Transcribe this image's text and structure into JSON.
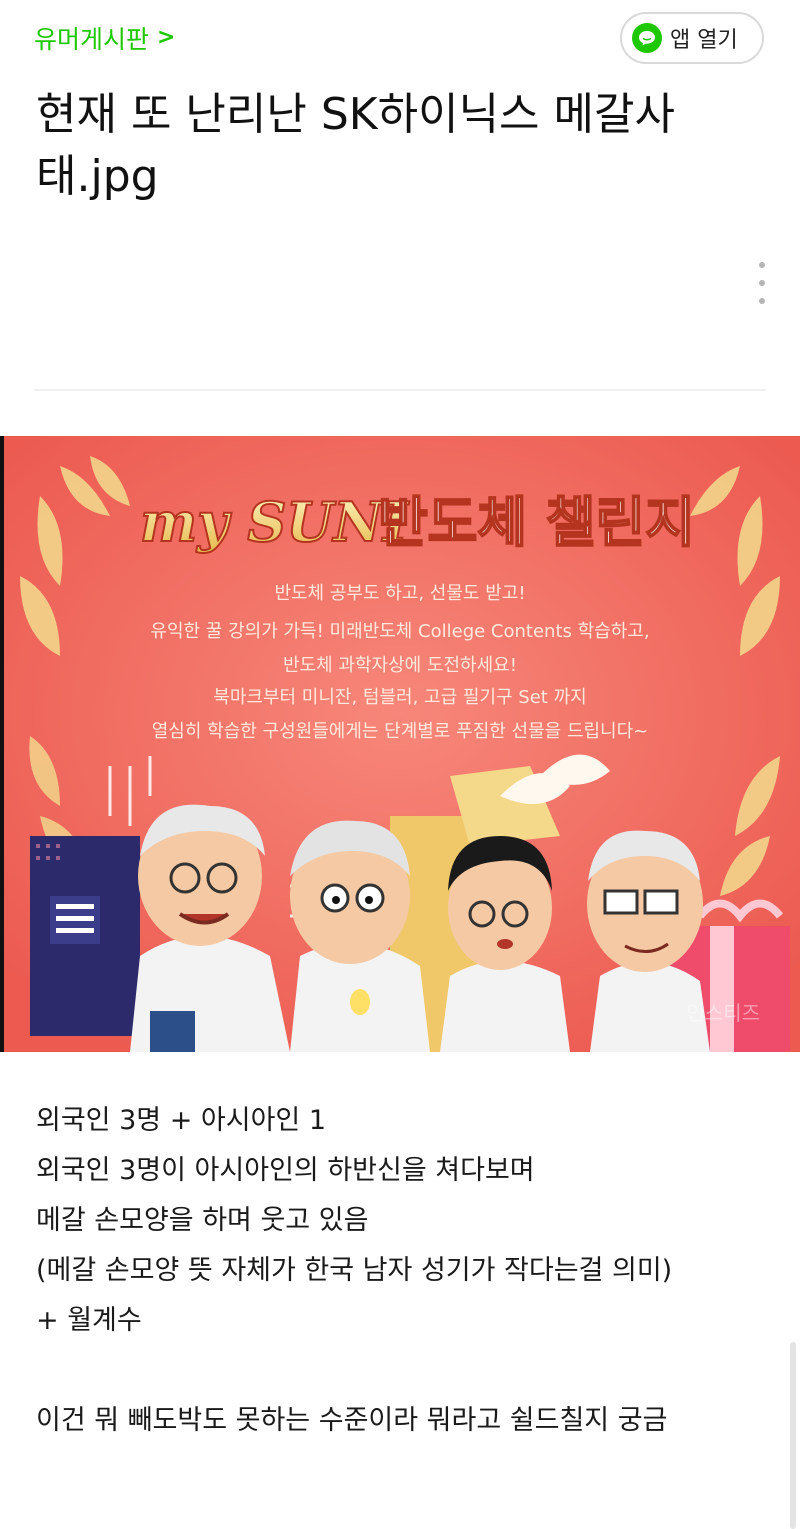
{
  "header": {
    "board_name": "유머게시판",
    "chevron": ">",
    "app_open_label": "앱 열기",
    "app_icon": "speech-bubble-icon",
    "accent_color": "#1ec800"
  },
  "post": {
    "title_line1": "현재 또 난리난 SK하이닉스 메갈사",
    "title_line2": "태.jpg",
    "more_icon": "more-vertical-icon"
  },
  "image": {
    "main_title_latin": "my SUNI",
    "main_title_korean": "반도체 챌린지",
    "subtitle": "반도체 공부도 하고, 선물도 받고!",
    "line1": "유익한 꿀 강의가 가득! 미래반도체 College Contents 학습하고,",
    "line2": "반도체 과학자상에 도전하세요!",
    "line3": "북마크부터 미니잔, 텀블러, 고급 필기구 Set 까지",
    "line4": "열심히 학습한 구성원들에게는 단계별로 푸짐한 선물을 드립니다~",
    "watermark": "인스티즈",
    "background_color": "#f26b60"
  },
  "content": {
    "paragraph_lines": [
      "외국인 3명 + 아시아인 1",
      "외국인 3명이 아시아인의 하반신을 쳐다보며",
      "메갈 손모양을 하며 웃고 있음",
      "(메갈 손모양 뜻 자체가 한국 남자 성기가 작다는걸 의미)",
      "+ 월계수"
    ],
    "closing_line": "이건 뭐 빼도박도 못하는 수준이라 뭐라고 쉴드칠지 궁금"
  }
}
